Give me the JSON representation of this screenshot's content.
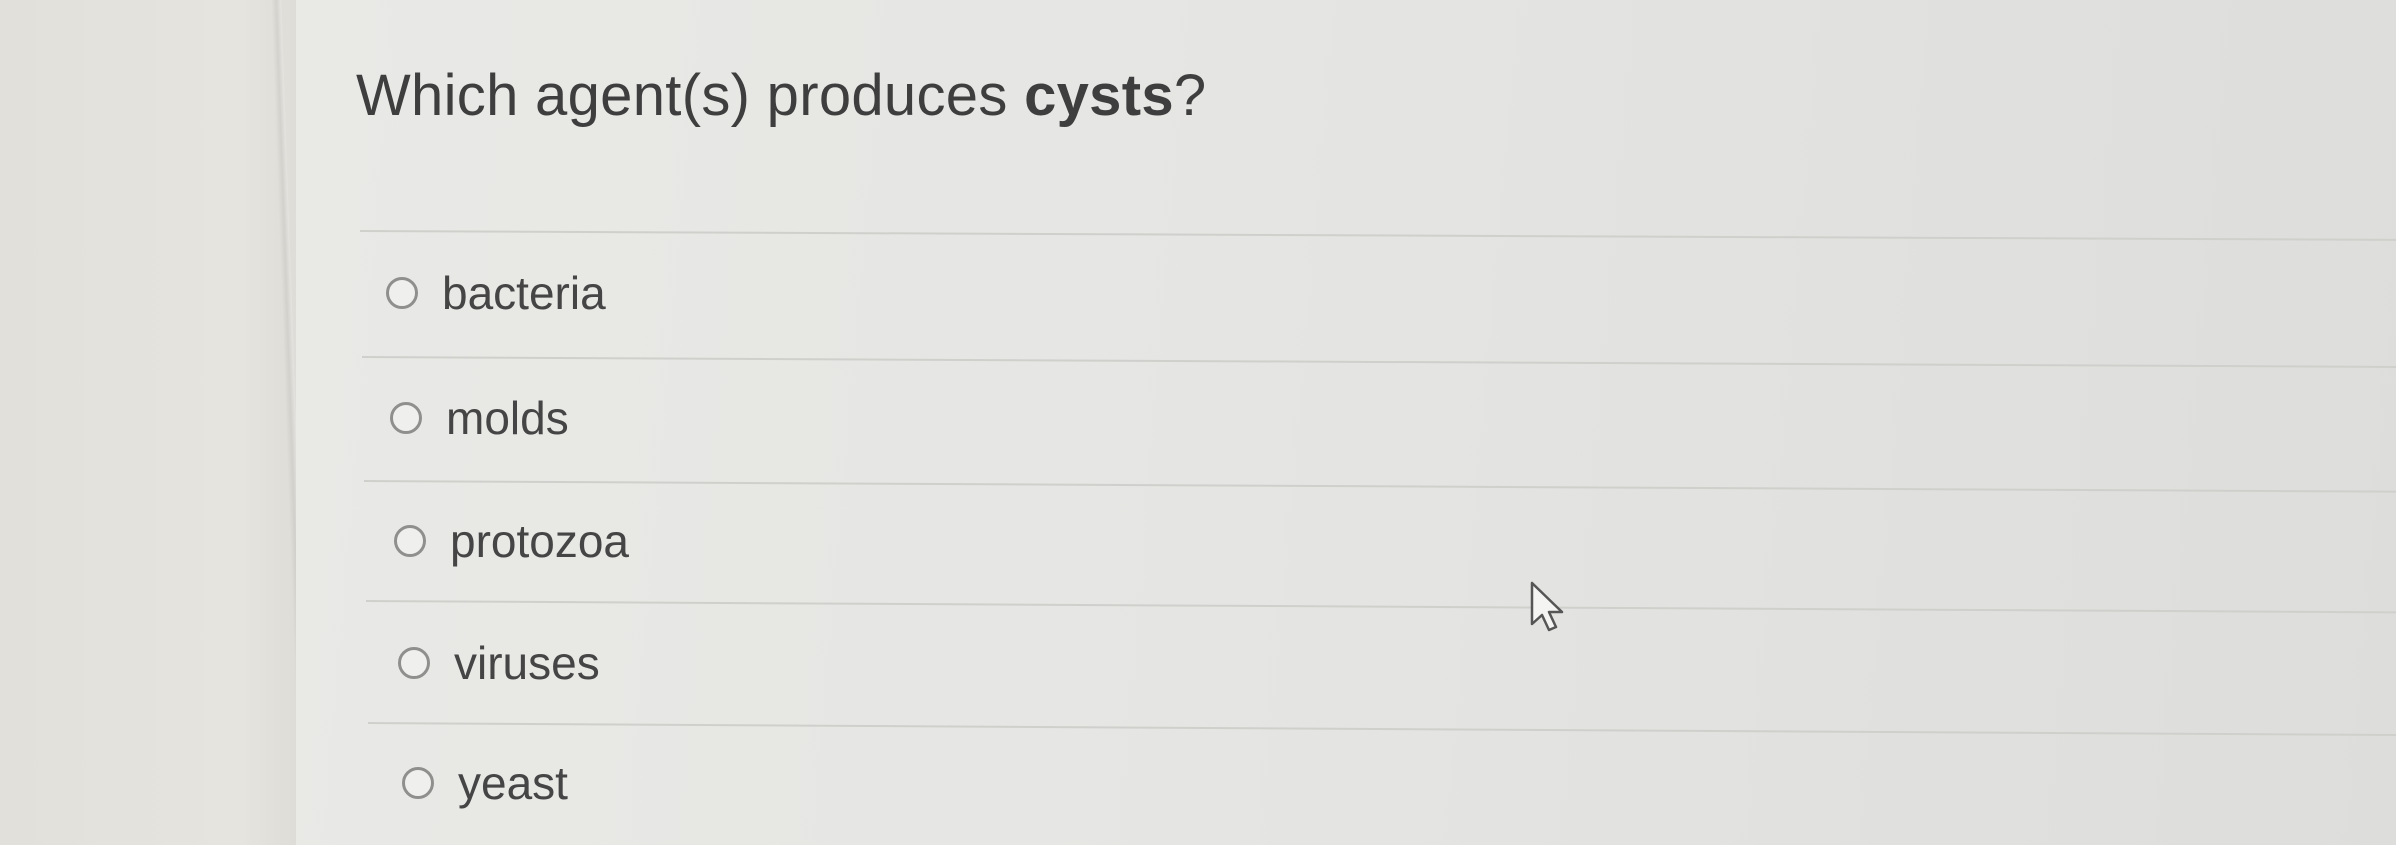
{
  "question": {
    "prefix": "Which agent(s) produces ",
    "emphasis": "cysts",
    "suffix": "?"
  },
  "options": [
    {
      "label": "bacteria",
      "selected": false
    },
    {
      "label": "molds",
      "selected": false
    },
    {
      "label": "protozoa",
      "selected": false
    },
    {
      "label": "viruses",
      "selected": false
    },
    {
      "label": "yeast",
      "selected": false
    }
  ],
  "cursor": {
    "icon": "arrow-pointer-icon"
  }
}
